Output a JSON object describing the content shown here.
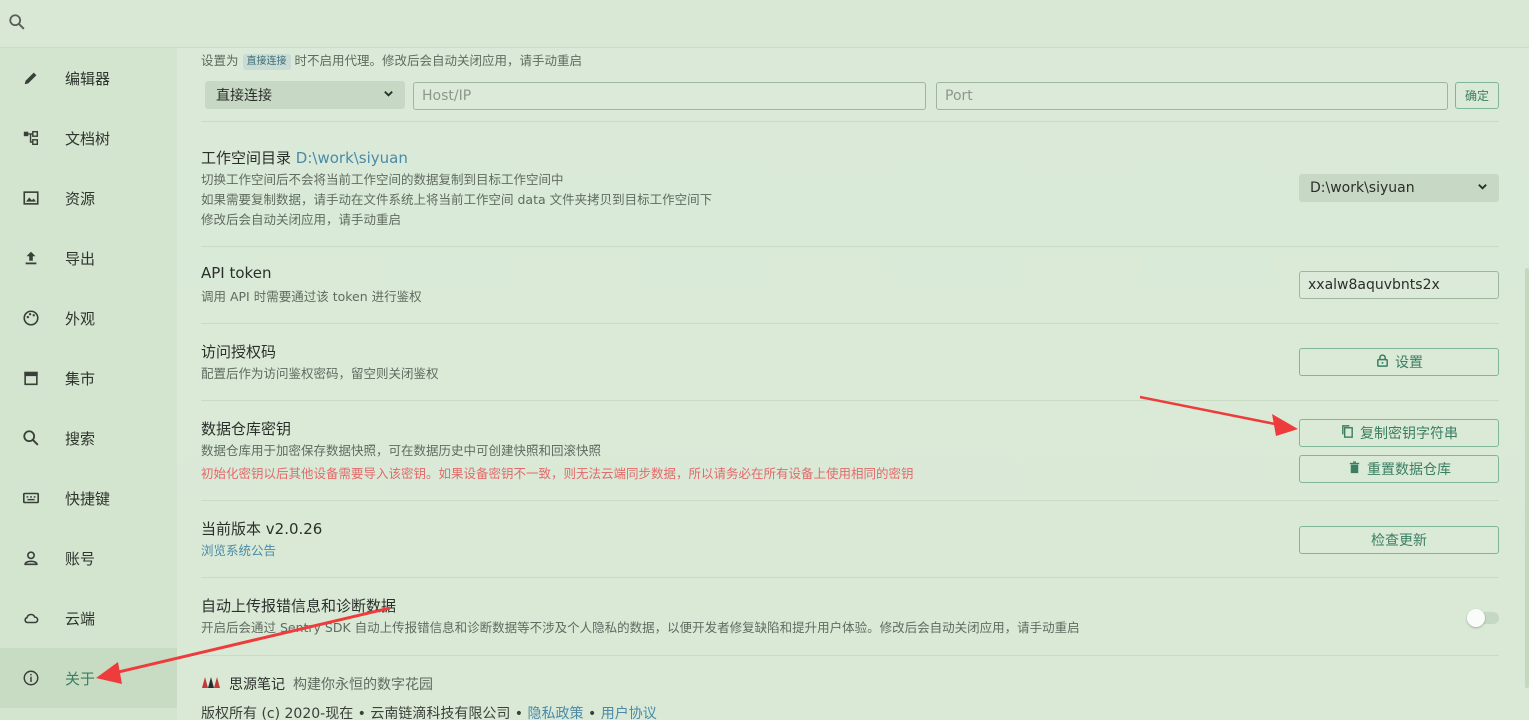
{
  "sidebar": {
    "items": [
      {
        "label": "编辑器",
        "icon": "pencil-icon"
      },
      {
        "label": "文档树",
        "icon": "tree-icon"
      },
      {
        "label": "资源",
        "icon": "image-icon"
      },
      {
        "label": "导出",
        "icon": "upload-icon"
      },
      {
        "label": "外观",
        "icon": "palette-icon"
      },
      {
        "label": "集市",
        "icon": "store-icon"
      },
      {
        "label": "搜索",
        "icon": "search-icon"
      },
      {
        "label": "快捷键",
        "icon": "keyboard-icon"
      },
      {
        "label": "账号",
        "icon": "user-icon"
      },
      {
        "label": "云端",
        "icon": "cloud-icon"
      },
      {
        "label": "关于",
        "icon": "info-icon",
        "active": true
      }
    ]
  },
  "proxy": {
    "desc_prefix": "设置为",
    "desc_tag": "直接连接",
    "desc_suffix": "时不启用代理。修改后会自动关闭应用，请手动重启",
    "mode_value": "直接连接",
    "host_placeholder": "Host/IP",
    "port_placeholder": "Port",
    "confirm_label": "确定"
  },
  "workspace": {
    "title": "工作空间目录",
    "path": "D:\\work\\siyuan",
    "desc_lines": [
      "切换工作空间后不会将当前工作空间的数据复制到目标工作空间中",
      "如果需要复制数据，请手动在文件系统上将当前工作空间 data 文件夹拷贝到目标工作空间下",
      "修改后会自动关闭应用，请手动重启"
    ],
    "select_value": "D:\\work\\siyuan"
  },
  "api_token": {
    "title": "API token",
    "desc": "调用 API 时需要通过该 token 进行鉴权",
    "value": "xxalw8aquvbnts2x"
  },
  "access_code": {
    "title": "访问授权码",
    "desc": "配置后作为访问鉴权密码，留空则关闭鉴权",
    "button_label": "设置"
  },
  "repo_key": {
    "title": "数据仓库密钥",
    "desc": "数据仓库用于加密保存数据快照，可在数据历史中可创建快照和回滚快照",
    "warning": "初始化密钥以后其他设备需要导入该密钥。如果设备密钥不一致，则无法云端同步数据，所以请务必在所有设备上使用相同的密钥",
    "copy_label": "复制密钥字符串",
    "reset_label": "重置数据仓库"
  },
  "version": {
    "title": "当前版本 v2.0.26",
    "link": "浏览系统公告",
    "button_label": "检查更新"
  },
  "telemetry": {
    "title": "自动上传报错信息和诊断数据",
    "desc": "开启后会通过 Sentry SDK 自动上传报错信息和诊断数据等不涉及个人隐私的数据，以便开发者修复缺陷和提升用户体验。修改后会自动关闭应用，请手动重启",
    "enabled": false
  },
  "footer": {
    "app_name": "思源笔记",
    "slogan": "构建你永恒的数字花园",
    "copyright": "版权所有 (c) 2020-现在 • 云南链滴科技有限公司 •",
    "privacy": "隐私政策",
    "sep": "•",
    "terms": "用户协议"
  },
  "colors": {
    "accent": "#3b7e63",
    "warning": "#e26a6a",
    "link": "#4a8aa7",
    "annotation_arrow": "#ee3b3b"
  }
}
